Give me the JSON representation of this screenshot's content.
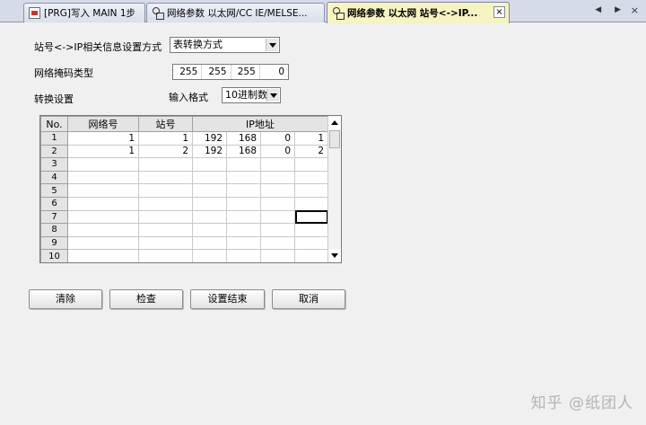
{
  "tabs": [
    {
      "label": "[PRG]写入 MAIN 1步",
      "icon": "program-doc-icon"
    },
    {
      "label": "网络参数 以太网/CC IE/MELSE...",
      "icon": "network-param-icon"
    },
    {
      "label": "网络参数 以太网 站号<->IP...",
      "icon": "network-param-icon",
      "active": true
    }
  ],
  "tab_close": "×",
  "nav": {
    "arrows": "◀ ▶",
    "close": "×"
  },
  "form": {
    "method_label": "站号<->IP相关信息设置方式",
    "method_value": "表转换方式",
    "mask_label": "网络掩码类型",
    "mask": [
      "255",
      "255",
      "255",
      "0"
    ],
    "conversion_label": "转换设置",
    "input_format_label": "输入格式",
    "input_format_value": "10进制数"
  },
  "table": {
    "headers": {
      "no": "No.",
      "network": "网络号",
      "station": "站号",
      "ip": "IP地址"
    },
    "rows": [
      {
        "no": "1",
        "network": "1",
        "station": "1",
        "ip": [
          "192",
          "168",
          "0",
          "1"
        ]
      },
      {
        "no": "2",
        "network": "1",
        "station": "2",
        "ip": [
          "192",
          "168",
          "0",
          "2"
        ]
      },
      {
        "no": "3",
        "network": "",
        "station": "",
        "ip": [
          "",
          "",
          "",
          ""
        ]
      },
      {
        "no": "4",
        "network": "",
        "station": "",
        "ip": [
          "",
          "",
          "",
          ""
        ]
      },
      {
        "no": "5",
        "network": "",
        "station": "",
        "ip": [
          "",
          "",
          "",
          ""
        ]
      },
      {
        "no": "6",
        "network": "",
        "station": "",
        "ip": [
          "",
          "",
          "",
          ""
        ]
      },
      {
        "no": "7",
        "network": "",
        "station": "",
        "ip": [
          "",
          "",
          "",
          ""
        ]
      },
      {
        "no": "8",
        "network": "",
        "station": "",
        "ip": [
          "",
          "",
          "",
          ""
        ]
      },
      {
        "no": "9",
        "network": "",
        "station": "",
        "ip": [
          "",
          "",
          "",
          ""
        ]
      },
      {
        "no": "10",
        "network": "",
        "station": "",
        "ip": [
          "",
          "",
          "",
          ""
        ]
      }
    ],
    "selected_cell": {
      "row": 7,
      "col": "ip4"
    }
  },
  "buttons": {
    "clear": "清除",
    "check": "检查",
    "finish": "设置结束",
    "cancel": "取消"
  },
  "watermark": "知乎 @纸团人",
  "colors": {
    "active_tab": "#f7f3c2",
    "tabbar": "#d6dbe9",
    "background": "#f0f0f0"
  }
}
